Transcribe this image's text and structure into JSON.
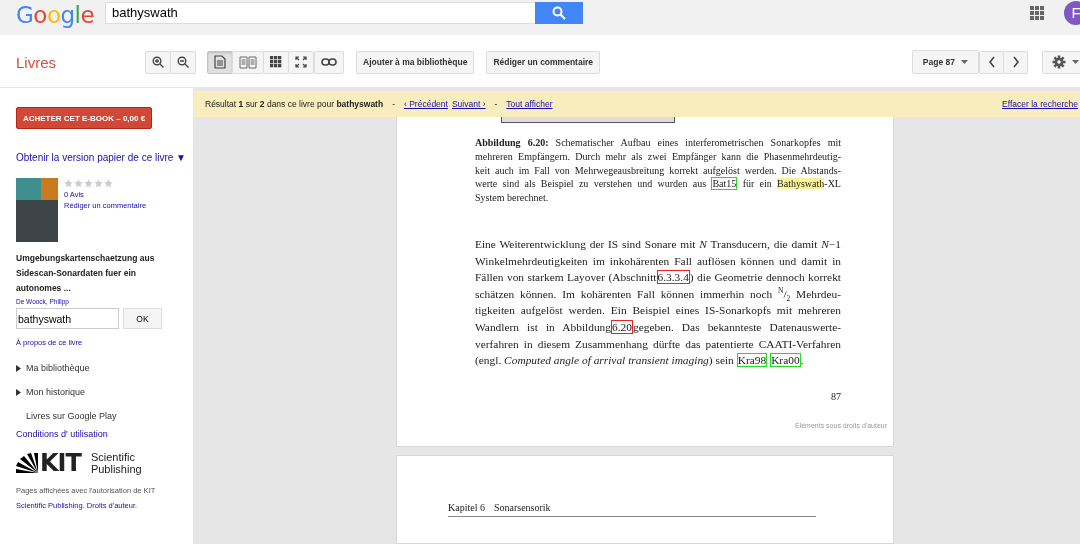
{
  "header": {
    "logo": "Google",
    "search": {
      "value": "bathyswath"
    },
    "avatar": "F"
  },
  "toolbar": {
    "title": "Livres",
    "view_modes": [
      {
        "kind": "single",
        "selected": true
      },
      {
        "kind": "double",
        "selected": false
      },
      {
        "kind": "grid",
        "selected": false
      },
      {
        "kind": "fullscreen",
        "selected": false
      }
    ],
    "actions": [
      "Ajouter à ma bibliothèque",
      "Rédiger un commentaire"
    ],
    "page_menu": "Page 87"
  },
  "notice": {
    "summary": "Résultat **1** sur **2** dans ce livre pour **bathyswath**",
    "separators": [
      "-",
      "-"
    ],
    "prev": "‹ Précédent",
    "next": "Suivant ›",
    "show_all": "Tout afficher",
    "clear": "Effacer la recherche"
  },
  "sidebar": {
    "buy_button": "ACHETER CET E-BOOK – 0,00 €",
    "print_link": "Obtenir la version papier de ce livre ▼",
    "book": {
      "stars": 0,
      "reviews": "0 Avis",
      "write_review": "Rédiger un commentaire",
      "title": "Umgebungskartenschaetzung aus Sidescan-Sonardaten fuer ein autonomes ...",
      "author": "De Woock, Philipp"
    },
    "search": {
      "value": "bathyswath",
      "button": "OK"
    },
    "about": "À propos de ce livre",
    "nav": [
      {
        "label": "Ma bibliothèque",
        "expandable": true
      },
      {
        "label": "Mon historique",
        "expandable": true
      },
      {
        "label": "Livres sur Google Play",
        "expandable": false
      }
    ],
    "terms": "Conditions d' utilisation",
    "publisher_logo": {
      "mark": "KIT",
      "name_lines": [
        "Scientific",
        "Publishing"
      ]
    },
    "permission": {
      "text": "Pages affichées avec l'autorisation de KIT",
      "link": "Scientific Publishing. Droits d'auteur."
    }
  },
  "page": {
    "caption_lines": [
      [
        {
          "kind": "text",
          "text": "**Abbildung 6.20:** Schematischer Aufbau eines interferometrischen Sonarkopfes mit"
        }
      ],
      [
        {
          "kind": "text",
          "text": "mehreren Empfängern. Durch mehr als zwei Empfänger kann die Phasenmehrdeutig-"
        }
      ],
      [
        {
          "kind": "text",
          "text": "keit auch im Fall von Mehrwegeausbreitung korrekt aufgelöst werden. Die Abstands-"
        }
      ],
      [
        {
          "kind": "text",
          "text": "werte sind als Beispiel zu verstehen und wurden aus "
        },
        {
          "kind": "ref",
          "text": "Bat15",
          "color": "#22dd22"
        },
        {
          "kind": "text",
          "text": " für ein "
        },
        {
          "kind": "highlight",
          "text": "Bathyswath"
        },
        {
          "kind": "text",
          "text": "-XL"
        }
      ],
      [
        {
          "kind": "text",
          "text": "System berechnet."
        }
      ]
    ],
    "body_lines": [
      [
        {
          "kind": "text",
          "text": "Eine Weiterentwicklung der IS sind Sonare mit *N* Transducern, die damit *N*−1"
        }
      ],
      [
        {
          "kind": "text",
          "text": "Winkelmehrdeutigkeiten im inkohärenten Fall auflösen können und damit in"
        }
      ],
      [
        {
          "kind": "text",
          "text": "Fällen von starkem Layover (Abschnitt"
        },
        {
          "kind": "ref",
          "text": "6.3.3.4",
          "color": "#ee2222"
        },
        {
          "kind": "text",
          "text": ") die Geometrie dennoch korrekt"
        }
      ],
      [
        {
          "kind": "text",
          "text": "schätzen können. Im kohärenten Fall können immerhin noch $^{N}$/$_{2}$ Mehrdeu-"
        }
      ],
      [
        {
          "kind": "text",
          "text": "tigkeiten aufgelöst werden. Ein Beispiel eines IS-Sonarkopfs mit mehreren"
        }
      ],
      [
        {
          "kind": "text",
          "text": "Wandlern ist in Abbildung"
        },
        {
          "kind": "ref",
          "text": "6.20",
          "color": "#ee2222"
        },
        {
          "kind": "text",
          "text": "gegeben. Das bekannteste Datenauswerte-"
        }
      ],
      [
        {
          "kind": "text",
          "text": "verfahren in diesem Zusammenhang dürfte das patentierte CAATI-Verfahren"
        }
      ],
      [
        {
          "kind": "text",
          "text": "(engl. *Computed angle of arrival transient imaging*) sein "
        },
        {
          "kind": "ref",
          "text": "Kra98",
          "color": "#22dd22"
        },
        {
          "kind": "ref",
          "text": "Kra00",
          "color": "#22dd22"
        },
        {
          "kind": "text",
          "text": "."
        }
      ]
    ],
    "page_number": "87",
    "copyright": "Éléments sous droits d'auteur"
  },
  "next_page": {
    "chapter": "Kapitel 6",
    "section": "Sonarsensorik"
  }
}
